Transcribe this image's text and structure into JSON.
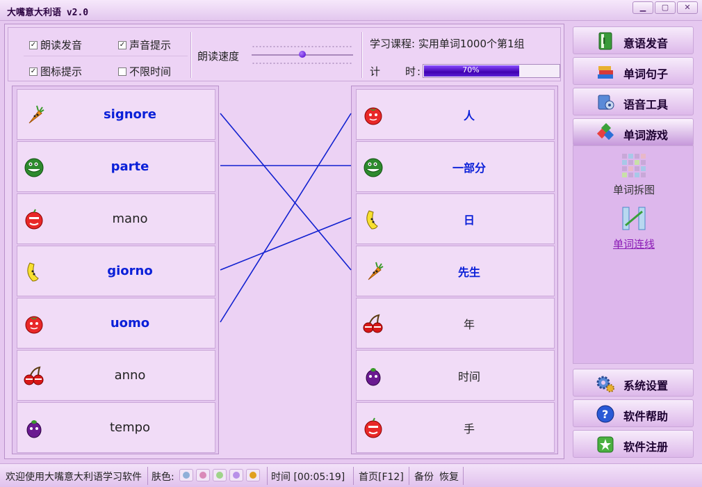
{
  "window": {
    "title": "大嘴意大利语 v2.0",
    "minimize_icon": "minimize-icon",
    "maximize_icon": "maximize-icon",
    "close_icon": "close-icon"
  },
  "options": {
    "read_aloud": {
      "label": "朗读发音",
      "checked": true
    },
    "sound_hint": {
      "label": "声音提示",
      "checked": true
    },
    "icon_hint": {
      "label": "图标提示",
      "checked": true
    },
    "no_time_limit": {
      "label": "不限时间",
      "checked": false
    }
  },
  "speed": {
    "label": "朗读速度",
    "value_fraction": 0.5
  },
  "course": {
    "label": "学习课程:",
    "value": "实用单词1000个第1组"
  },
  "timer": {
    "label": "计　　时:",
    "progress_percent": 70,
    "progress_text": "70%"
  },
  "left_words": [
    {
      "text": "signore",
      "fruit": "carrot-icon",
      "matched": true
    },
    {
      "text": "parte",
      "fruit": "watermelon-icon",
      "matched": true
    },
    {
      "text": "mano",
      "fruit": "apple-icon",
      "matched": false
    },
    {
      "text": "giorno",
      "fruit": "banana-icon",
      "matched": true
    },
    {
      "text": "uomo",
      "fruit": "tomato-icon",
      "matched": true
    },
    {
      "text": "anno",
      "fruit": "cherry-icon",
      "matched": false
    },
    {
      "text": "tempo",
      "fruit": "eggplant-icon",
      "matched": false
    }
  ],
  "right_words": [
    {
      "text": "人",
      "fruit": "tomato-icon",
      "matched": true
    },
    {
      "text": "一部分",
      "fruit": "watermelon-icon",
      "matched": true
    },
    {
      "text": "日",
      "fruit": "banana-icon",
      "matched": true
    },
    {
      "text": "先生",
      "fruit": "carrot-icon",
      "matched": true
    },
    {
      "text": "年",
      "fruit": "cherry-icon",
      "matched": false
    },
    {
      "text": "时间",
      "fruit": "eggplant-icon",
      "matched": false
    },
    {
      "text": "手",
      "fruit": "apple-icon",
      "matched": false
    }
  ],
  "connections": [
    [
      0,
      3
    ],
    [
      1,
      1
    ],
    [
      3,
      2
    ],
    [
      4,
      0
    ]
  ],
  "sidebar": {
    "pronunciation": {
      "label": "意语发音",
      "icon": "book-icon"
    },
    "sentences": {
      "label": "单词句子",
      "icon": "books-stack-icon"
    },
    "voice_tool": {
      "label": "语音工具",
      "icon": "voice-tool-icon"
    },
    "word_game": {
      "label": "单词游戏",
      "icon": "game-icon"
    },
    "games": [
      {
        "label": "单词拆图",
        "icon": "puzzle-grid-icon",
        "selected": false
      },
      {
        "label": "单词连线",
        "icon": "word-link-icon",
        "selected": true
      }
    ],
    "settings": {
      "label": "系统设置",
      "icon": "gear-icon"
    },
    "help": {
      "label": "软件帮助",
      "icon": "help-icon"
    },
    "register": {
      "label": "软件注册",
      "icon": "register-icon"
    }
  },
  "statusbar": {
    "welcome": "欢迎使用大嘴意大利语学习软件",
    "skin_label": "肤色:",
    "skins": [
      "#8fb0d8",
      "#d98ab8",
      "#9fd48a",
      "#b890e8",
      "#e0a020"
    ],
    "time": "时间 [00:05:19]",
    "home": "首页[F12]",
    "backup": "备份",
    "restore": "恢复"
  }
}
